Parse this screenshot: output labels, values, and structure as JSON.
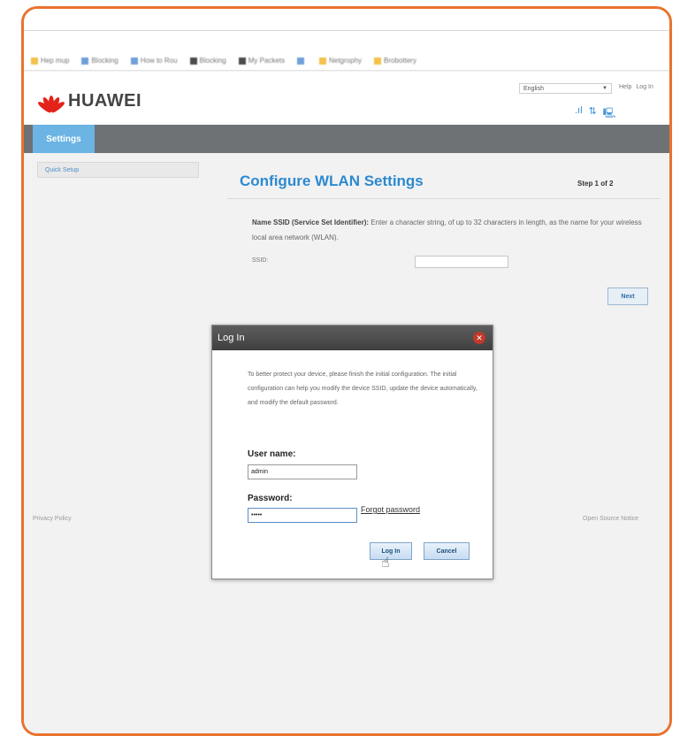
{
  "bookmarks": [
    {
      "label": "Hep mup",
      "color": "y"
    },
    {
      "label": "Blocking",
      "color": "b"
    },
    {
      "label": "How to Rou",
      "color": "b"
    },
    {
      "label": "Blocking",
      "color": "g"
    },
    {
      "label": "My Packets",
      "color": "g"
    },
    {
      "label": "",
      "color": "b"
    },
    {
      "label": "Netgrophy",
      "color": "y"
    },
    {
      "label": "Brobottery",
      "color": "y"
    }
  ],
  "header": {
    "brand": "HUAWEI",
    "language": "English",
    "links": [
      "Help",
      "Log In"
    ]
  },
  "nav": {
    "tab": "Settings"
  },
  "sidebar": {
    "items": [
      "Quick Setup"
    ]
  },
  "main": {
    "title": "Configure WLAN Settings",
    "step": "Step 1 of 2",
    "desc_bold": "Name SSID (Service Set Identifier):",
    "desc_rest": "Enter a character string, of up to 32 characters in length, as the name for your wireless local area network (WLAN).",
    "ssid_label": "SSID:",
    "next_label": "Next"
  },
  "footer": {
    "left": "Privacy Policy",
    "right": "Open Source Notice"
  },
  "login_dialog": {
    "title": "Log In",
    "message": "To better protect your device, please finish the initial configuration. The initial configuration can help you modify the device SSID, update the device automatically, and modify the default password.",
    "username_label": "User name:",
    "username_value": "admin",
    "password_label": "Password:",
    "password_value": "•••••",
    "forgot_label": "Forgot password",
    "login_button": "Log In",
    "cancel_button": "Cancel"
  },
  "colors": {
    "frame_border": "#e8732e",
    "accent_blue": "#2c8ad0",
    "tab_blue": "#6bb4e4",
    "close_red": "#c0392b"
  }
}
